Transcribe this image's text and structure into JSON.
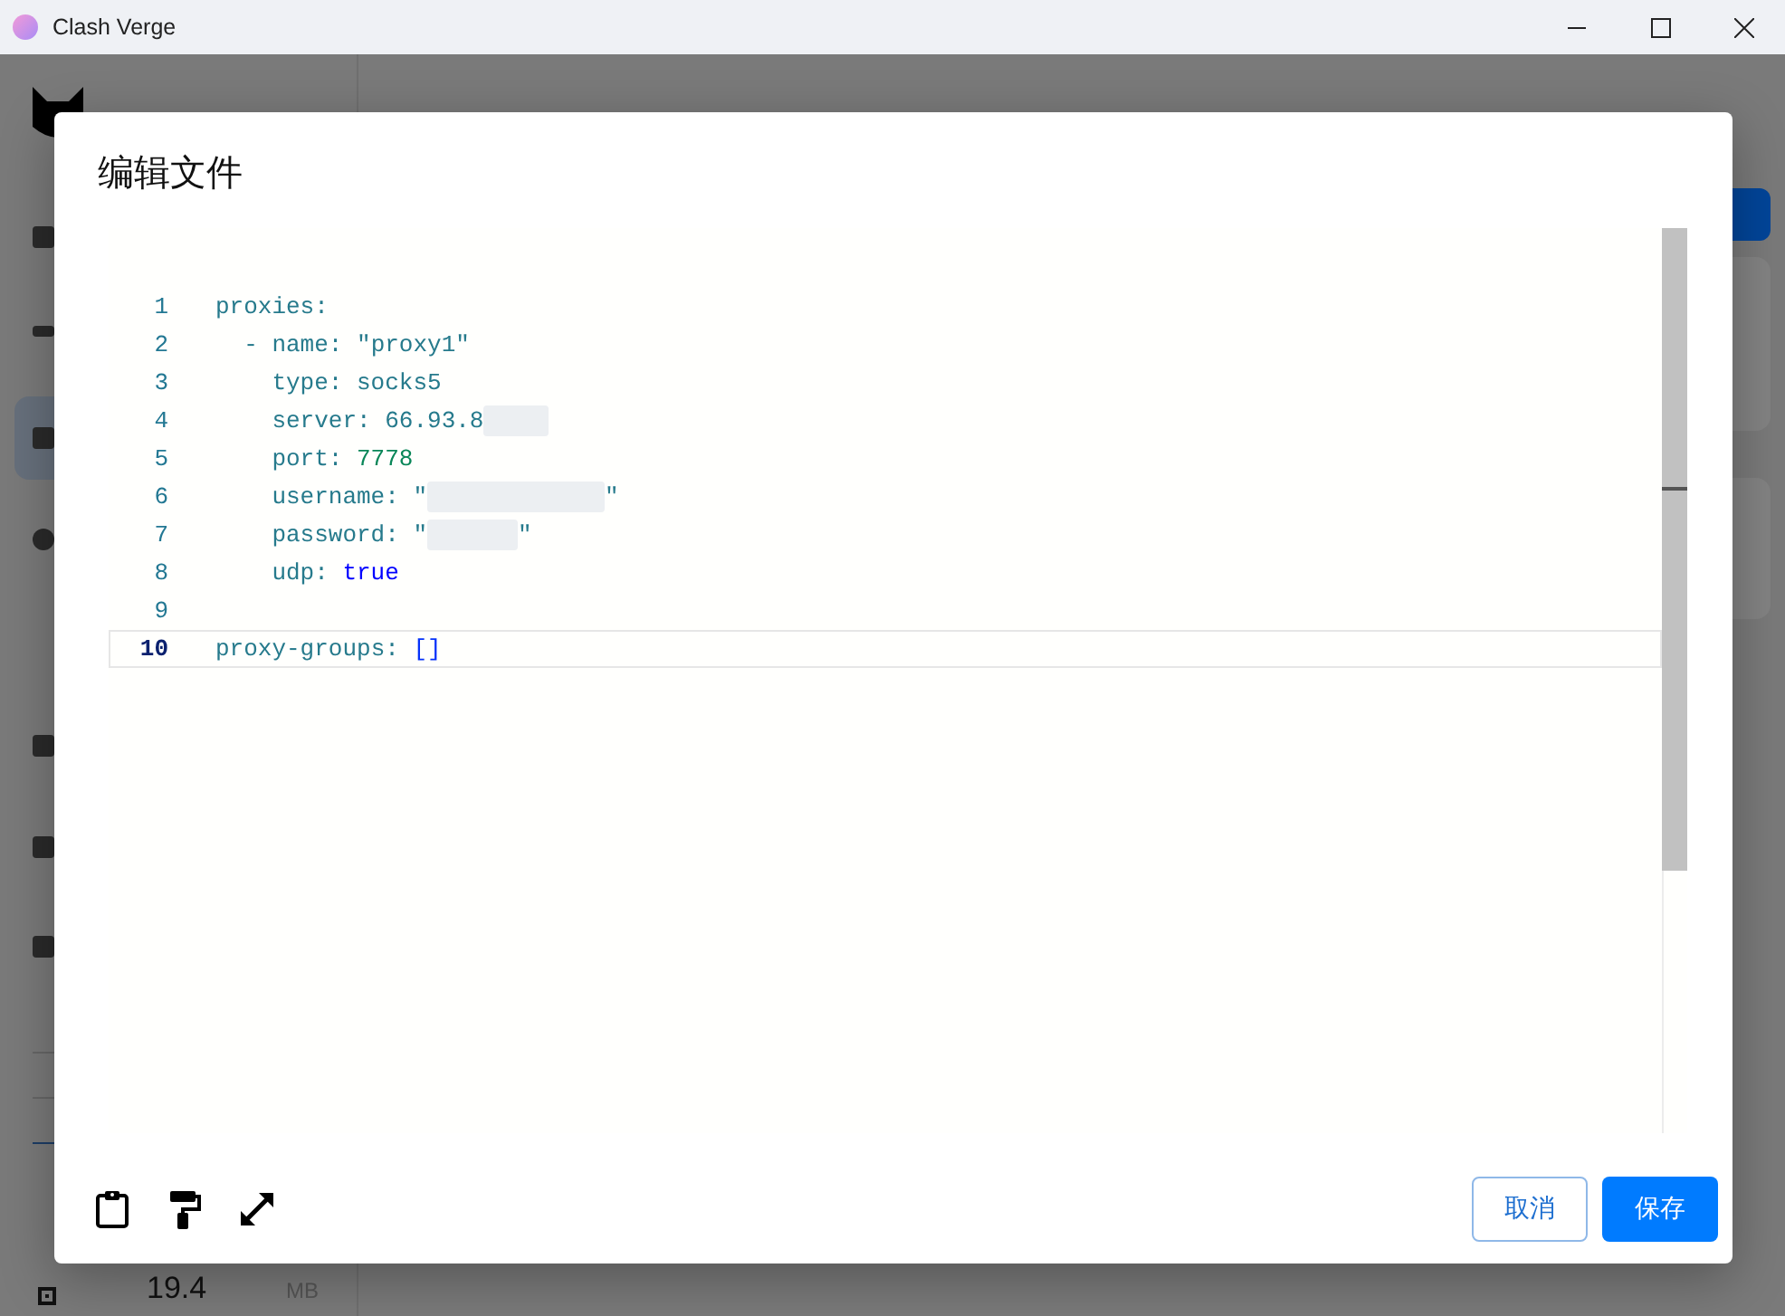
{
  "window": {
    "title": "Clash Verge"
  },
  "background": {
    "memory_value": "19.4",
    "memory_unit": "MB"
  },
  "dialog": {
    "title": "编辑文件",
    "editor": {
      "lines": [
        {
          "number": "1",
          "kind": "top",
          "selected": false,
          "tokens": [
            {
              "kind": "key",
              "text": "proxies:"
            }
          ]
        },
        {
          "number": "2",
          "kind": "list-item",
          "selected": false,
          "tokens": [
            {
              "kind": "punct",
              "text": "- "
            },
            {
              "kind": "key",
              "text": "name: "
            },
            {
              "kind": "string",
              "text": "\"proxy1\""
            }
          ]
        },
        {
          "number": "3",
          "kind": "field",
          "selected": false,
          "tokens": [
            {
              "kind": "key",
              "text": "type: "
            },
            {
              "kind": "string",
              "text": "socks5"
            }
          ]
        },
        {
          "number": "4",
          "kind": "field",
          "selected": false,
          "tokens": [
            {
              "kind": "key",
              "text": "server: "
            },
            {
              "kind": "string",
              "text": "66.93.8"
            },
            {
              "kind": "redacted-short"
            }
          ]
        },
        {
          "number": "5",
          "kind": "field",
          "selected": false,
          "tokens": [
            {
              "kind": "key",
              "text": "port: "
            },
            {
              "kind": "number",
              "text": "7778"
            }
          ]
        },
        {
          "number": "6",
          "kind": "field",
          "selected": false,
          "tokens": [
            {
              "kind": "key",
              "text": "username: "
            },
            {
              "kind": "string",
              "text": "\""
            },
            {
              "kind": "redacted-long"
            },
            {
              "kind": "string",
              "text": "\""
            }
          ]
        },
        {
          "number": "7",
          "kind": "field",
          "selected": false,
          "tokens": [
            {
              "kind": "key",
              "text": "password: "
            },
            {
              "kind": "string",
              "text": "\""
            },
            {
              "kind": "redacted-medium"
            },
            {
              "kind": "string",
              "text": "\""
            }
          ]
        },
        {
          "number": "8",
          "kind": "field",
          "selected": false,
          "tokens": [
            {
              "kind": "key",
              "text": "udp: "
            },
            {
              "kind": "bool",
              "text": "true"
            }
          ]
        },
        {
          "number": "9",
          "kind": "blank",
          "selected": false
        },
        {
          "number": "10",
          "kind": "top",
          "selected": true,
          "tokens": [
            {
              "kind": "key",
              "text": "proxy-groups: "
            },
            {
              "kind": "bracket",
              "text": "[]"
            }
          ]
        }
      ]
    },
    "buttons": [
      {
        "label": "取消",
        "kind": "outlined"
      },
      {
        "label": "保存",
        "kind": "contained"
      }
    ]
  }
}
